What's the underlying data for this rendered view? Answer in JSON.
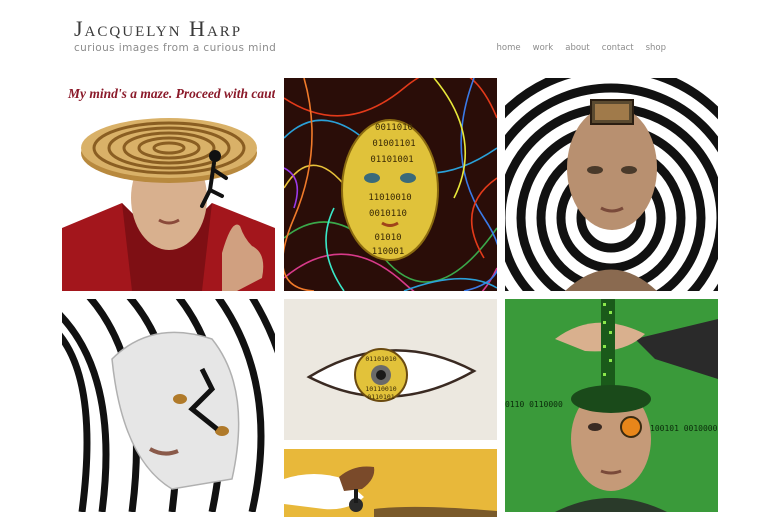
{
  "site": {
    "title": "Jacquelyn Harp",
    "tagline": "curious images from a curious mind"
  },
  "nav": {
    "items": [
      "home",
      "work",
      "about",
      "contact",
      "shop"
    ]
  },
  "gallery": {
    "tile1_caption": "My mind's a maze. Proceed with caution.",
    "tile2_binary_rows": [
      "0011010",
      "01001101",
      "01101001",
      "11010010",
      "0010110",
      "01010",
      "110001"
    ],
    "tile5_binary_rows": [
      "01101010",
      "10110010",
      "0110101"
    ],
    "tile6_binary_left": "0110 0110000",
    "tile6_binary_right": "100101 0010000"
  },
  "colors": {
    "background": "#ffffff",
    "title_text": "#3a3a3a",
    "muted_text": "#8c8c8c",
    "caption_red": "#8b1a2a"
  }
}
